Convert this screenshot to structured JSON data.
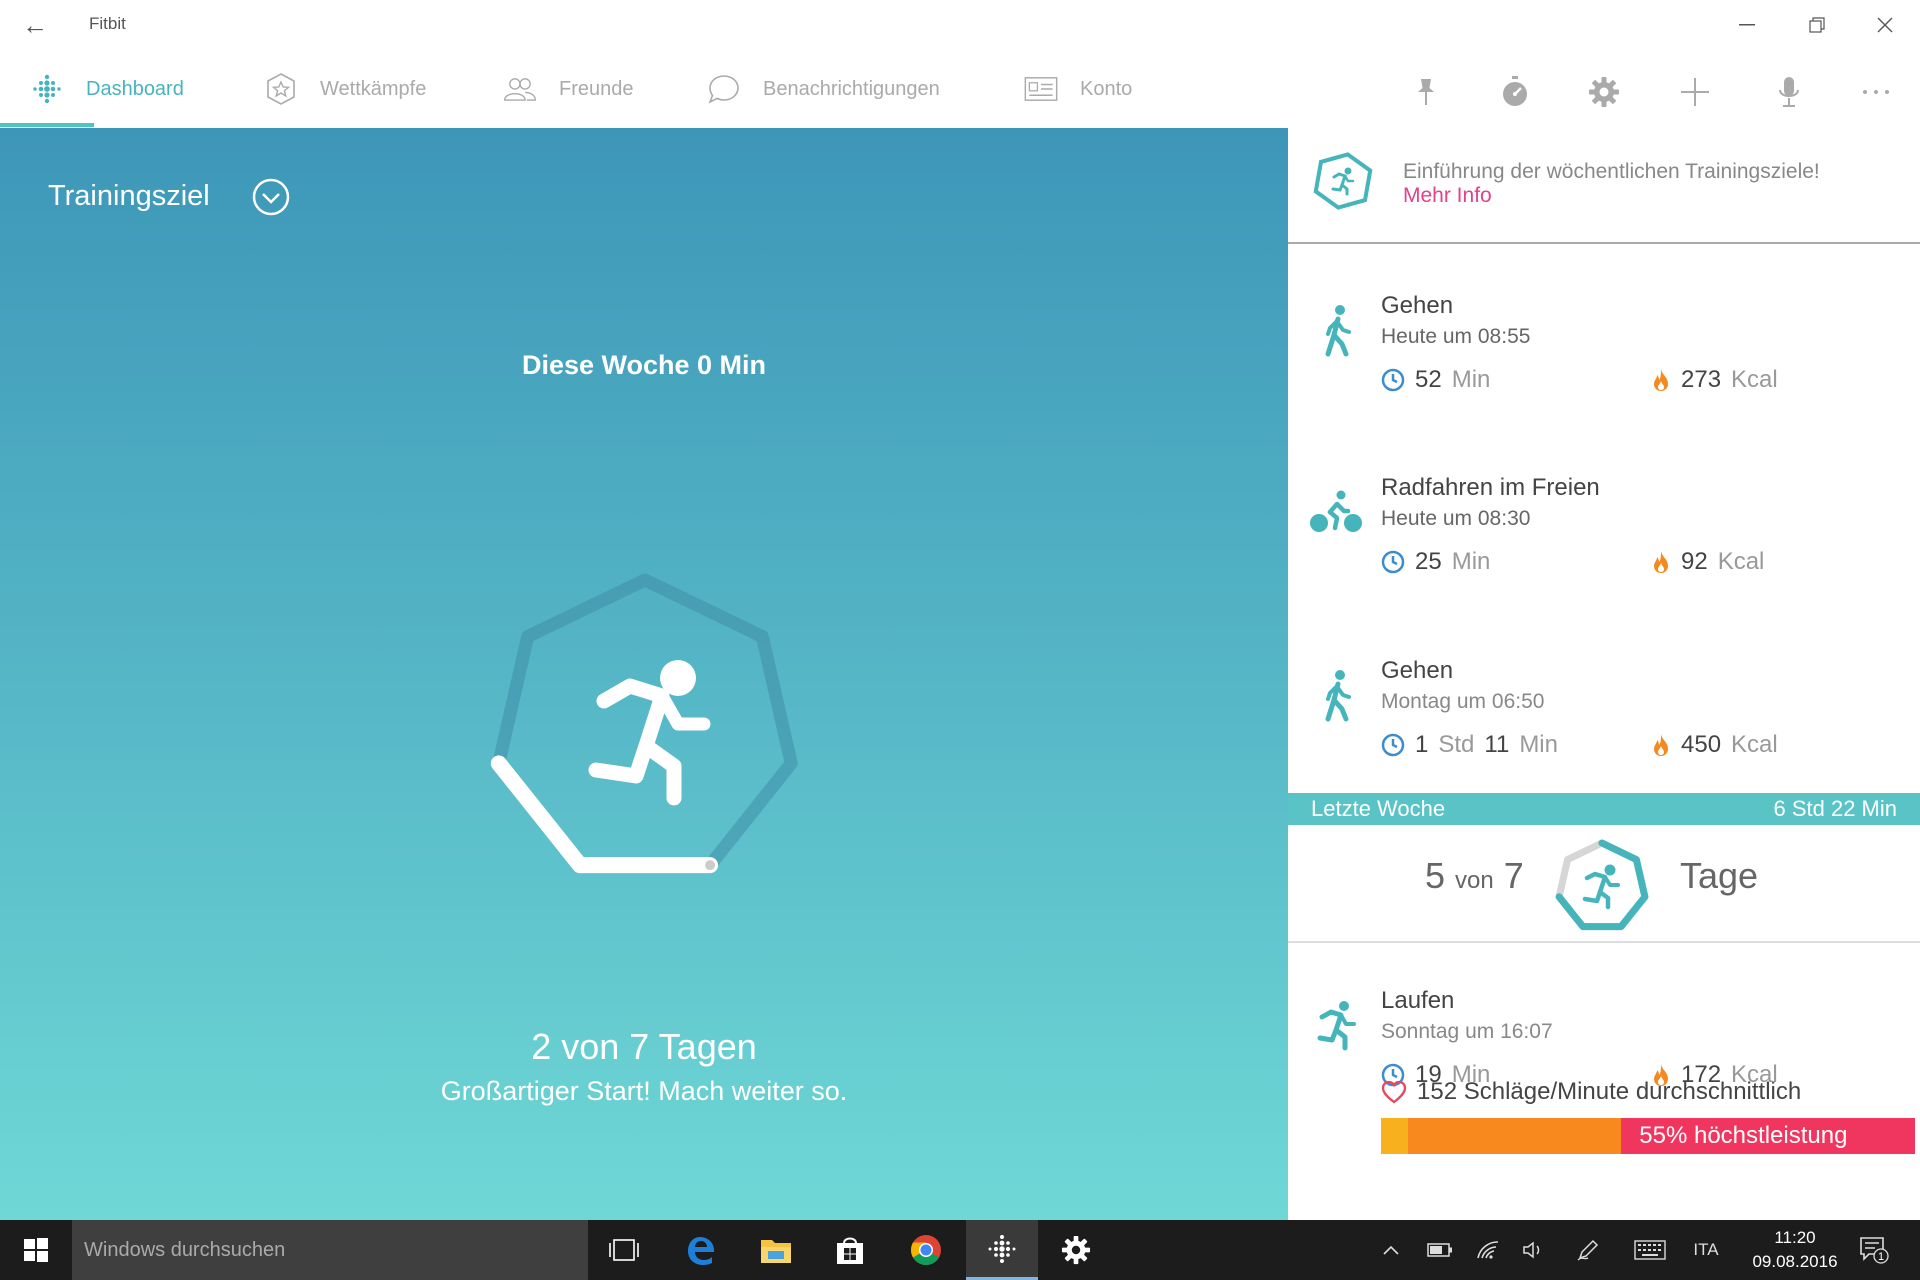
{
  "window": {
    "title": "Fitbit"
  },
  "nav": {
    "tabs": [
      {
        "label": "Dashboard",
        "icon": "dots-icon",
        "active": true
      },
      {
        "label": "Wettkämpfe",
        "icon": "star-badge-icon"
      },
      {
        "label": "Freunde",
        "icon": "friends-icon"
      },
      {
        "label": "Benachrichtigungen",
        "icon": "chat-bubble-icon"
      },
      {
        "label": "Konto",
        "icon": "id-card-icon"
      }
    ],
    "tools": [
      "pin-icon",
      "stopwatch-icon",
      "gear-icon",
      "plus-icon",
      "microphone-icon",
      "more-icon"
    ]
  },
  "goal": {
    "title": "Trainingsziel",
    "week_label": "Diese Woche 0 Min",
    "days_label": "2 von 7 Tagen",
    "encouragement": "Großartiger Start! Mach weiter so.",
    "progress": {
      "done": 2,
      "total": 7
    }
  },
  "promo": {
    "text": "Einführung der wöchentlichen Trainingsziele!",
    "link": "Mehr Info"
  },
  "activities": [
    {
      "name": "Gehen",
      "time": "Heute um 08:55",
      "duration_num": "52",
      "duration_unit": "Min",
      "kcal_num": "273",
      "kcal_unit": "Kcal",
      "icon": "walk-icon"
    },
    {
      "name": "Radfahren im Freien",
      "time": "Heute um 08:30",
      "duration_num": "25",
      "duration_unit": "Min",
      "kcal_num": "92",
      "kcal_unit": "Kcal",
      "icon": "bike-icon"
    },
    {
      "name": "Gehen",
      "time": "Montag um 06:50",
      "duration_h": "1",
      "duration_h_unit": "Std",
      "duration_m": "11",
      "duration_m_unit": "Min",
      "kcal_num": "450",
      "kcal_unit": "Kcal",
      "icon": "walk-icon"
    }
  ],
  "last_week": {
    "label": "Letzte Woche",
    "total": "6 Std 22 Min",
    "count": "5",
    "of": "von",
    "total_days": "7",
    "unit": "Tage",
    "progress": {
      "done": 5,
      "total": 7
    }
  },
  "run": {
    "name": "Laufen",
    "time": "Sonntag um 16:07",
    "duration_num": "19",
    "duration_unit": "Min",
    "kcal_num": "172",
    "kcal_unit": "Kcal",
    "heart_rate": "152 Schläge/Minute durchschnittlich",
    "zone_label": "55% höchstleistung",
    "zones": [
      {
        "fraction": 0.05,
        "color": "#f8b01f"
      },
      {
        "fraction": 0.4,
        "color": "#f8891f"
      },
      {
        "fraction": 0.55,
        "color": "#f0365f"
      }
    ]
  },
  "colors": {
    "accent": "#4cc3c7",
    "link": "#e5408b",
    "clock_icon": "#3c8dd0",
    "flame": "#f5891f",
    "heart": "#e8485f"
  },
  "taskbar": {
    "search_placeholder": "Windows durchsuchen",
    "apps": [
      "task-view-icon",
      "edge-icon",
      "file-explorer-icon",
      "store-icon",
      "chrome-icon",
      "fitbit-icon",
      "settings-icon"
    ],
    "language": "ITA",
    "time": "11:20",
    "date": "09.08.2016",
    "notifications": "1"
  }
}
